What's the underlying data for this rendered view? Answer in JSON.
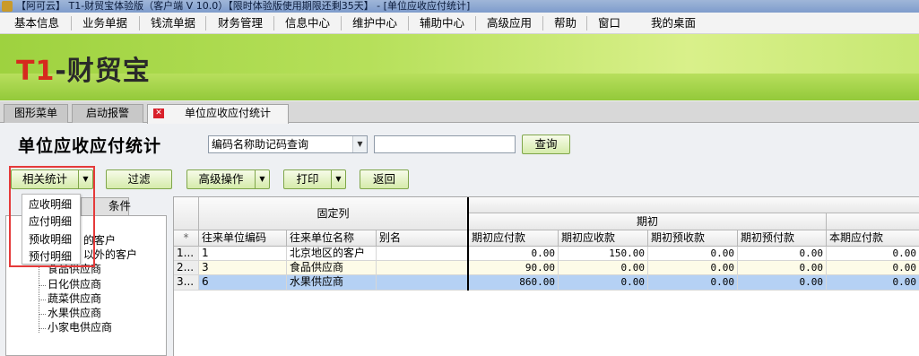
{
  "window": {
    "title": "【阿可云】 T1-财贸宝体验版（客户端 V 10.0）【限时体验版使用期限还剩35天】 - [单位应收应付统计]"
  },
  "menu": [
    "基本信息",
    "业务单据",
    "钱流单据",
    "财务管理",
    "信息中心",
    "维护中心",
    "辅助中心",
    "高级应用",
    "帮助",
    "窗口",
    "我的桌面"
  ],
  "banner": {
    "logo_t1": "T1",
    "logo_rest": "-财贸宝"
  },
  "tabs": [
    "图形菜单",
    "启动报警",
    "单位应收应付统计"
  ],
  "page": {
    "title": "单位应收应付统计"
  },
  "search": {
    "mode": "编码名称助记码查询",
    "value": "",
    "button": "查询"
  },
  "toolbar": {
    "related": "相关统计",
    "filter": "过滤",
    "advanced": "高级操作",
    "print": "打印",
    "back": "返回"
  },
  "related_menu": [
    "应收明细",
    "应付明细",
    "预收明细",
    "预付明细"
  ],
  "left_panel": {
    "tab_label": "条件",
    "tree": [
      "的客户",
      "以外的客户",
      "食品供应商",
      "日化供应商",
      "蔬菜供应商",
      "水果供应商",
      "小家电供应商"
    ]
  },
  "grid": {
    "group_fixed": "固定列",
    "group_initial": "期初",
    "corner": "*",
    "columns": [
      "往来单位编码",
      "往来单位名称",
      "别名",
      "期初应付款",
      "期初应收款",
      "期初预收款",
      "期初预付款",
      "本期应付款"
    ],
    "rows": [
      {
        "row": "1...",
        "code": "1",
        "name": "北京地区的客户",
        "alias": "",
        "v": [
          "0.00",
          "150.00",
          "0.00",
          "0.00",
          "0.00"
        ]
      },
      {
        "row": "2...",
        "code": "3",
        "name": "食品供应商",
        "alias": "",
        "v": [
          "90.00",
          "0.00",
          "0.00",
          "0.00",
          "0.00"
        ]
      },
      {
        "row": "3...",
        "code": "6",
        "name": "水果供应商",
        "alias": "",
        "v": [
          "860.00",
          "0.00",
          "0.00",
          "0.00",
          "0.00"
        ]
      }
    ]
  },
  "colors": {
    "selected_row": "#b5d1f4",
    "alt_row": "#fdfbe8",
    "highlight_outline": "#e53a3a",
    "button_border": "#7fa64a"
  }
}
